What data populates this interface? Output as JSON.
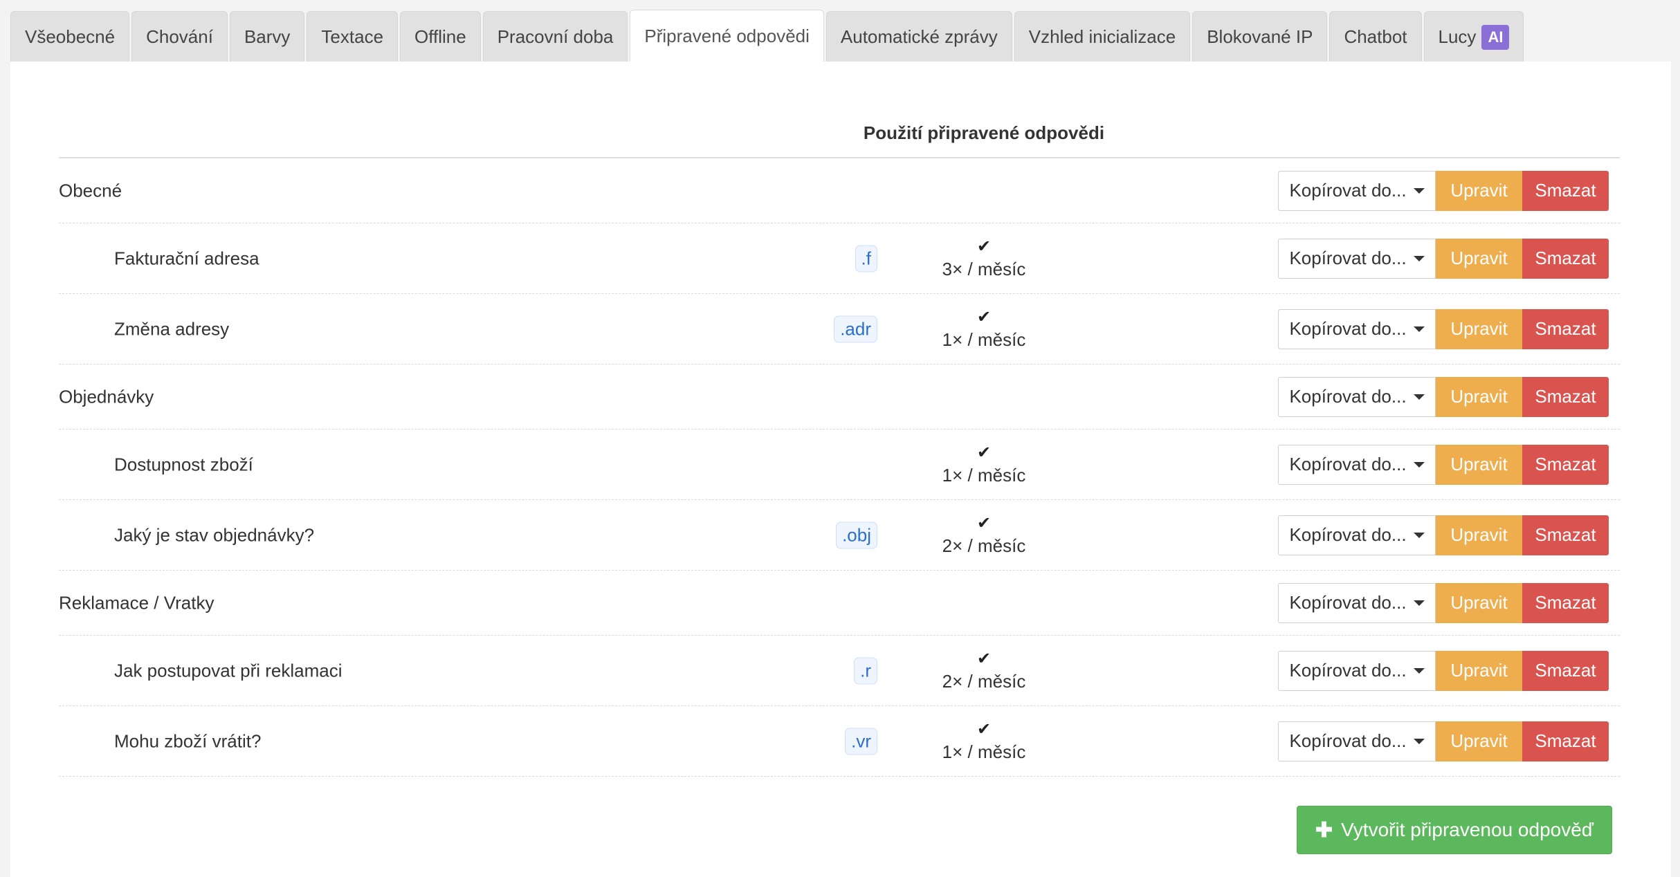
{
  "tabs": [
    {
      "label": "Všeobecné"
    },
    {
      "label": "Chování"
    },
    {
      "label": "Barvy"
    },
    {
      "label": "Textace"
    },
    {
      "label": "Offline"
    },
    {
      "label": "Pracovní doba"
    },
    {
      "label": "Připravené odpovědi",
      "active": true
    },
    {
      "label": "Automatické zprávy"
    },
    {
      "label": "Vzhled inicializace"
    },
    {
      "label": "Blokované IP"
    },
    {
      "label": "Chatbot"
    },
    {
      "label": "Lucy",
      "badge": "AI"
    }
  ],
  "table": {
    "usage_header": "Použití připravené odpovědi",
    "rows": [
      {
        "type": "category",
        "name": "Obecné"
      },
      {
        "type": "item",
        "name": "Fakturační adresa",
        "shortcut": ".f",
        "usage": "3× / měsíc"
      },
      {
        "type": "item",
        "name": "Změna adresy",
        "shortcut": ".adr",
        "usage": "1× / měsíc"
      },
      {
        "type": "category",
        "name": "Objednávky"
      },
      {
        "type": "item",
        "name": "Dostupnost zboží",
        "shortcut": "",
        "usage": "1× / měsíc"
      },
      {
        "type": "item",
        "name": "Jaký je stav objednávky?",
        "shortcut": ".obj",
        "usage": "2× / měsíc"
      },
      {
        "type": "category",
        "name": "Reklamace / Vratky"
      },
      {
        "type": "item",
        "name": "Jak postupovat při reklamaci",
        "shortcut": ".r",
        "usage": "2× / měsíc"
      },
      {
        "type": "item",
        "name": "Mohu zboží vrátit?",
        "shortcut": ".vr",
        "usage": "1× / měsíc"
      }
    ]
  },
  "actions": {
    "copy_label": "Kopírovat do...",
    "edit_label": "Upravit",
    "delete_label": "Smazat",
    "usage_icon": "check-icon",
    "dropdown_icon": "caret-down-icon"
  },
  "create_button": {
    "label": "Vytvořit připravenou odpověď",
    "icon": "plus-icon"
  },
  "colors": {
    "edit": "#efae4e",
    "delete": "#d9534f",
    "create": "#5cb85c",
    "ai_badge": "#8c6fd6",
    "shortcut_text": "#2a6fc9"
  }
}
